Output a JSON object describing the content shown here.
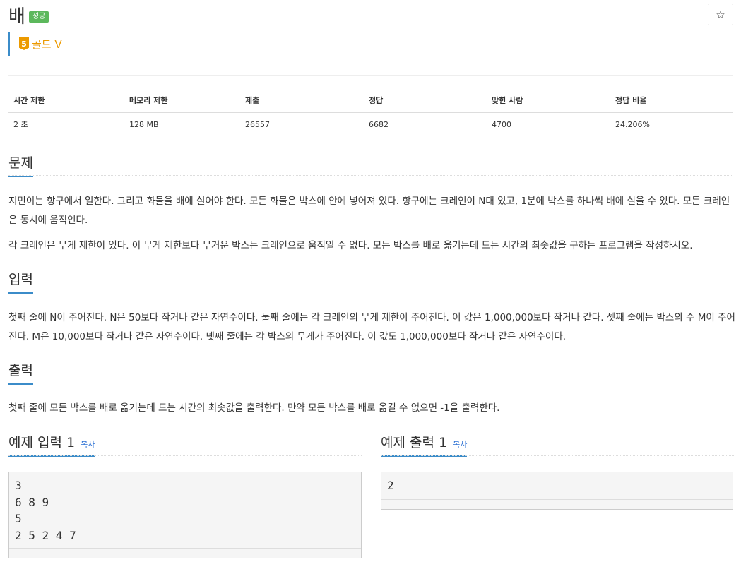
{
  "problem": {
    "title": "배",
    "result_badge": "성공",
    "star_label": "☆",
    "tier_number": "5",
    "tier_label": "골드 V"
  },
  "info_table": {
    "headers": [
      "시간 제한",
      "메모리 제한",
      "제출",
      "정답",
      "맞힌 사람",
      "정답 비율"
    ],
    "values": [
      "2 초",
      "128 MB",
      "26557",
      "6682",
      "4700",
      "24.206%"
    ]
  },
  "sections": {
    "description": {
      "heading": "문제",
      "paragraphs": [
        "지민이는 항구에서 일한다. 그리고 화물을 배에 실어야 한다. 모든 화물은 박스에 안에 넣어져 있다. 항구에는 크레인이 N대 있고, 1분에 박스를 하나씩 배에 실을 수 있다. 모든 크레인은 동시에 움직인다.",
        "각 크레인은 무게 제한이 있다. 이 무게 제한보다 무거운 박스는 크레인으로 움직일 수 없다. 모든 박스를 배로 옮기는데 드는 시간의 최솟값을 구하는 프로그램을 작성하시오."
      ]
    },
    "input": {
      "heading": "입력",
      "paragraphs": [
        "첫째 줄에 N이 주어진다. N은 50보다 작거나 같은 자연수이다. 둘째 줄에는 각 크레인의 무게 제한이 주어진다. 이 값은 1,000,000보다 작거나 같다. 셋째 줄에는 박스의 수 M이 주어진다. M은 10,000보다 작거나 같은 자연수이다. 넷째 줄에는 각 박스의 무게가 주어진다. 이 값도 1,000,000보다 작거나 같은 자연수이다."
      ]
    },
    "output": {
      "heading": "출력",
      "paragraphs": [
        "첫째 줄에 모든 박스를 배로 옮기는데 드는 시간의 최솟값을 출력한다. 만약 모든 박스를 배로 옮길 수 없으면 -1을 출력한다."
      ]
    }
  },
  "samples": {
    "input": {
      "heading": "예제 입력 1",
      "copy_label": "복사",
      "lines": [
        "3",
        "6 8 9",
        "5",
        "2 5 2 4 7"
      ]
    },
    "output": {
      "heading": "예제 출력 1",
      "copy_label": "복사",
      "lines": [
        "2"
      ]
    }
  }
}
